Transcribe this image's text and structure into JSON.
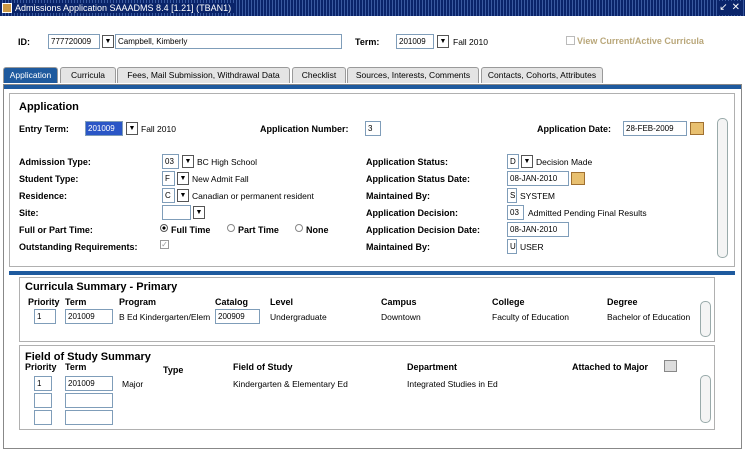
{
  "window": {
    "title": "Admissions Application  SAAADMS  8.4  [1.21]  (TBAN1)"
  },
  "key_block": {
    "id_label": "ID:",
    "id_value": "777720009",
    "name_value": "Campbell, Kimberly",
    "term_label": "Term:",
    "term_value": "201009",
    "term_desc": "Fall 2010",
    "view_curricula_label": "View Current/Active Curricula"
  },
  "tabs": [
    "Application",
    "Curricula",
    "Fees, Mail Submission, Withdrawal Data",
    "Checklist",
    "Sources, Interests, Comments",
    "Contacts, Cohorts, Attributes"
  ],
  "application": {
    "heading": "Application",
    "entry_term_label": "Entry Term:",
    "entry_term_value": "201009",
    "entry_term_desc": "Fall 2010",
    "app_number_label": "Application Number:",
    "app_number_value": "3",
    "app_date_label": "Application Date:",
    "app_date_value": "28-FEB-2009",
    "admission_type_label": "Admission Type:",
    "admission_type_code": "03",
    "admission_type_desc": "BC High School",
    "student_type_label": "Student Type:",
    "student_type_code": "F",
    "student_type_desc": "New Admit Fall",
    "residence_label": "Residence:",
    "residence_code": "C",
    "residence_desc": "Canadian or permanent resident",
    "site_label": "Site:",
    "full_part_label": "Full or Part Time:",
    "full_time": "Full Time",
    "part_time": "Part Time",
    "none": "None",
    "outstanding_label": "Outstanding Requirements:",
    "status_label": "Application Status:",
    "status_code": "D",
    "status_desc": "Decision Made",
    "status_date_label": "Application Status Date:",
    "status_date_value": "08-JAN-2010",
    "maintained_by_label": "Maintained By:",
    "maintained_by_code": "S",
    "maintained_by_desc": "SYSTEM",
    "decision_label": "Application Decision:",
    "decision_code": "03",
    "decision_desc": "Admitted Pending Final Results",
    "decision_date_label": "Application Decision Date:",
    "decision_date_value": "08-JAN-2010",
    "maintained_by2_label": "Maintained By:",
    "maintained_by2_code": "U",
    "maintained_by2_desc": "USER"
  },
  "curricula_summary": {
    "heading": "Curricula Summary   - Primary",
    "cols": {
      "priority": "Priority",
      "term": "Term",
      "program": "Program",
      "catalog": "Catalog",
      "level": "Level",
      "campus": "Campus",
      "college": "College",
      "degree": "Degree"
    },
    "row": {
      "priority": "1",
      "term": "201009",
      "program": "B Ed Kindergarten/Elem",
      "catalog": "200909",
      "level": "Undergraduate",
      "campus": "Downtown",
      "college": "Faculty of Education",
      "degree": "Bachelor of Education"
    }
  },
  "field_of_study": {
    "heading": "Field of Study Summary",
    "cols": {
      "priority": "Priority",
      "term": "Term",
      "type": "Type",
      "field": "Field of Study",
      "department": "Department",
      "attached": "Attached to Major"
    },
    "row": {
      "priority": "1",
      "term": "201009",
      "type": "Major",
      "field": "Kindergarten & Elementary Ed",
      "department": "Integrated Studies in Ed"
    }
  }
}
